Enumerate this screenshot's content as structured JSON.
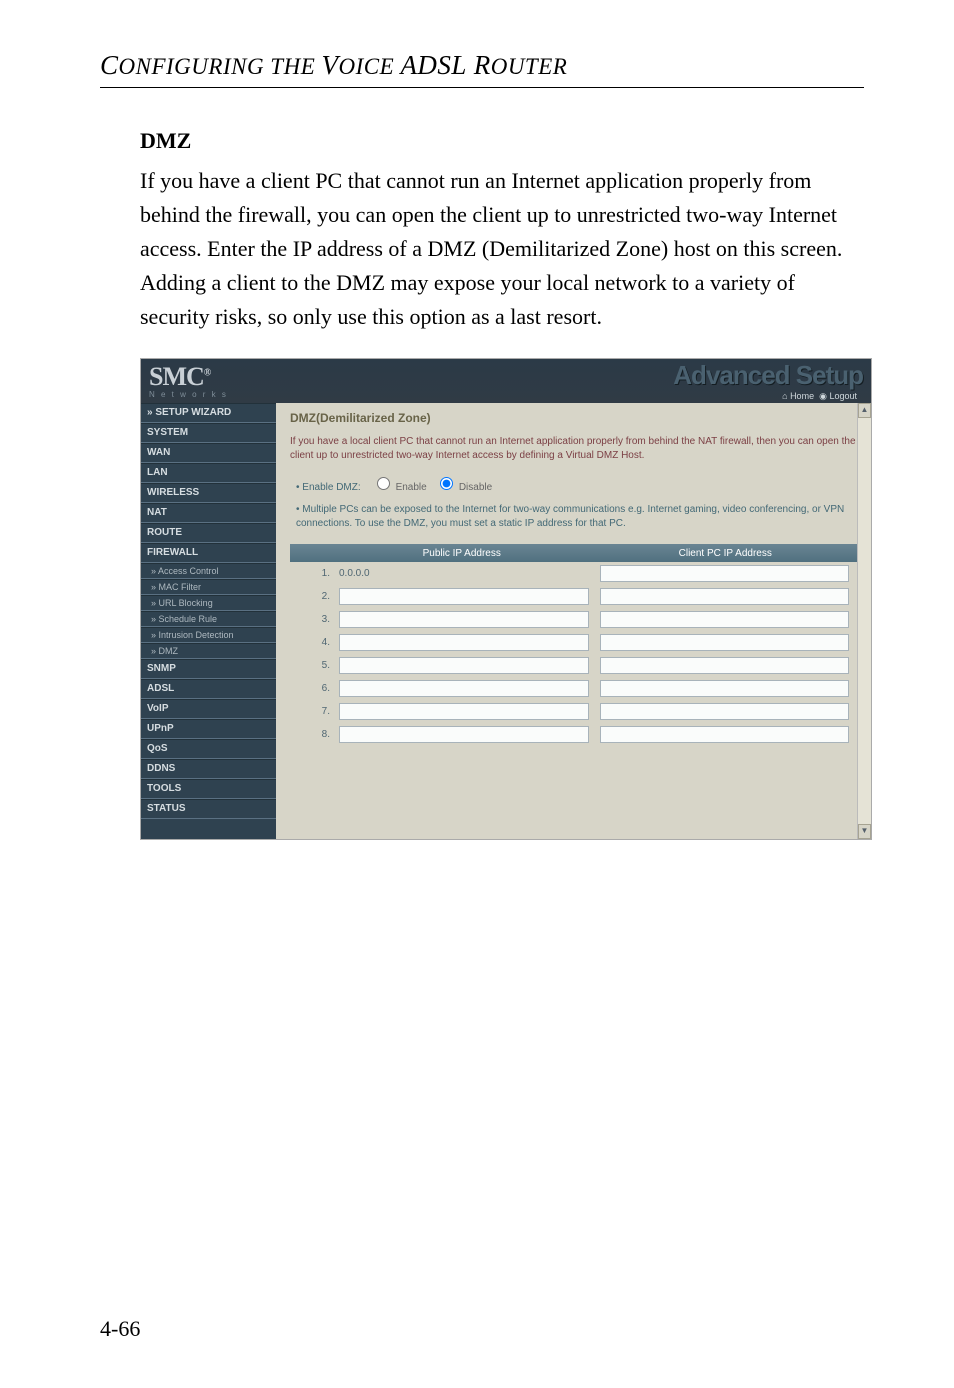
{
  "running_head": "Configuring the Voice ADSL Router",
  "section_title": "DMZ",
  "body_text": "If you have a client PC that cannot run an Internet application properly from behind the firewall, you can open the client up to unrestricted two-way Internet access. Enter the IP address of a DMZ (Demilitarized Zone) host on this screen. Adding a client to the DMZ may expose your local network to a variety of security risks, so only use this option as a last resort.",
  "page_number": "4-66",
  "screenshot": {
    "brand": "SMC",
    "brand_reg": "®",
    "brand_sub": "N e t w o r k s",
    "header_right": "Advanced Setup",
    "home_link": "Home",
    "logout_link": "Logout",
    "sidebar": [
      {
        "label": "» SETUP WIZARD",
        "type": "item"
      },
      {
        "label": "SYSTEM",
        "type": "item"
      },
      {
        "label": "WAN",
        "type": "item"
      },
      {
        "label": "LAN",
        "type": "item"
      },
      {
        "label": "WIRELESS",
        "type": "item"
      },
      {
        "label": "NAT",
        "type": "item"
      },
      {
        "label": "ROUTE",
        "type": "item"
      },
      {
        "label": "FIREWALL",
        "type": "item"
      },
      {
        "label": "» Access Control",
        "type": "subitem"
      },
      {
        "label": "» MAC Filter",
        "type": "subitem"
      },
      {
        "label": "» URL Blocking",
        "type": "subitem"
      },
      {
        "label": "» Schedule Rule",
        "type": "subitem"
      },
      {
        "label": "» Intrusion Detection",
        "type": "subitem"
      },
      {
        "label": "» DMZ",
        "type": "subitem"
      },
      {
        "label": "SNMP",
        "type": "item"
      },
      {
        "label": "ADSL",
        "type": "item"
      },
      {
        "label": "VoIP",
        "type": "item"
      },
      {
        "label": "UPnP",
        "type": "item"
      },
      {
        "label": "QoS",
        "type": "item"
      },
      {
        "label": "DDNS",
        "type": "item"
      },
      {
        "label": "TOOLS",
        "type": "item"
      },
      {
        "label": "STATUS",
        "type": "item"
      }
    ],
    "main_title": "DMZ(Demilitarized Zone)",
    "desc": "If you have a local client PC that cannot run an Internet application properly from behind the NAT firewall, then you can open the client up to unrestricted two-way Internet access by defining a Virtual DMZ Host.",
    "enable_label": "Enable DMZ:",
    "enable_opt": "Enable",
    "disable_opt": "Disable",
    "note": "Multiple PCs can be exposed to the Internet for two-way communications e.g. Internet gaming, video conferencing, or VPN connections. To use the DMZ, you must set a static IP address for that PC.",
    "th_pub": "Public IP Address",
    "th_cli": "Client PC IP Address",
    "rows": [
      {
        "n": "1.",
        "pub": "0.0.0.0",
        "cli": ""
      },
      {
        "n": "2.",
        "pub": "",
        "cli": ""
      },
      {
        "n": "3.",
        "pub": "",
        "cli": ""
      },
      {
        "n": "4.",
        "pub": "",
        "cli": ""
      },
      {
        "n": "5.",
        "pub": "",
        "cli": ""
      },
      {
        "n": "6.",
        "pub": "",
        "cli": ""
      },
      {
        "n": "7.",
        "pub": "",
        "cli": ""
      },
      {
        "n": "8.",
        "pub": "",
        "cli": ""
      }
    ]
  }
}
